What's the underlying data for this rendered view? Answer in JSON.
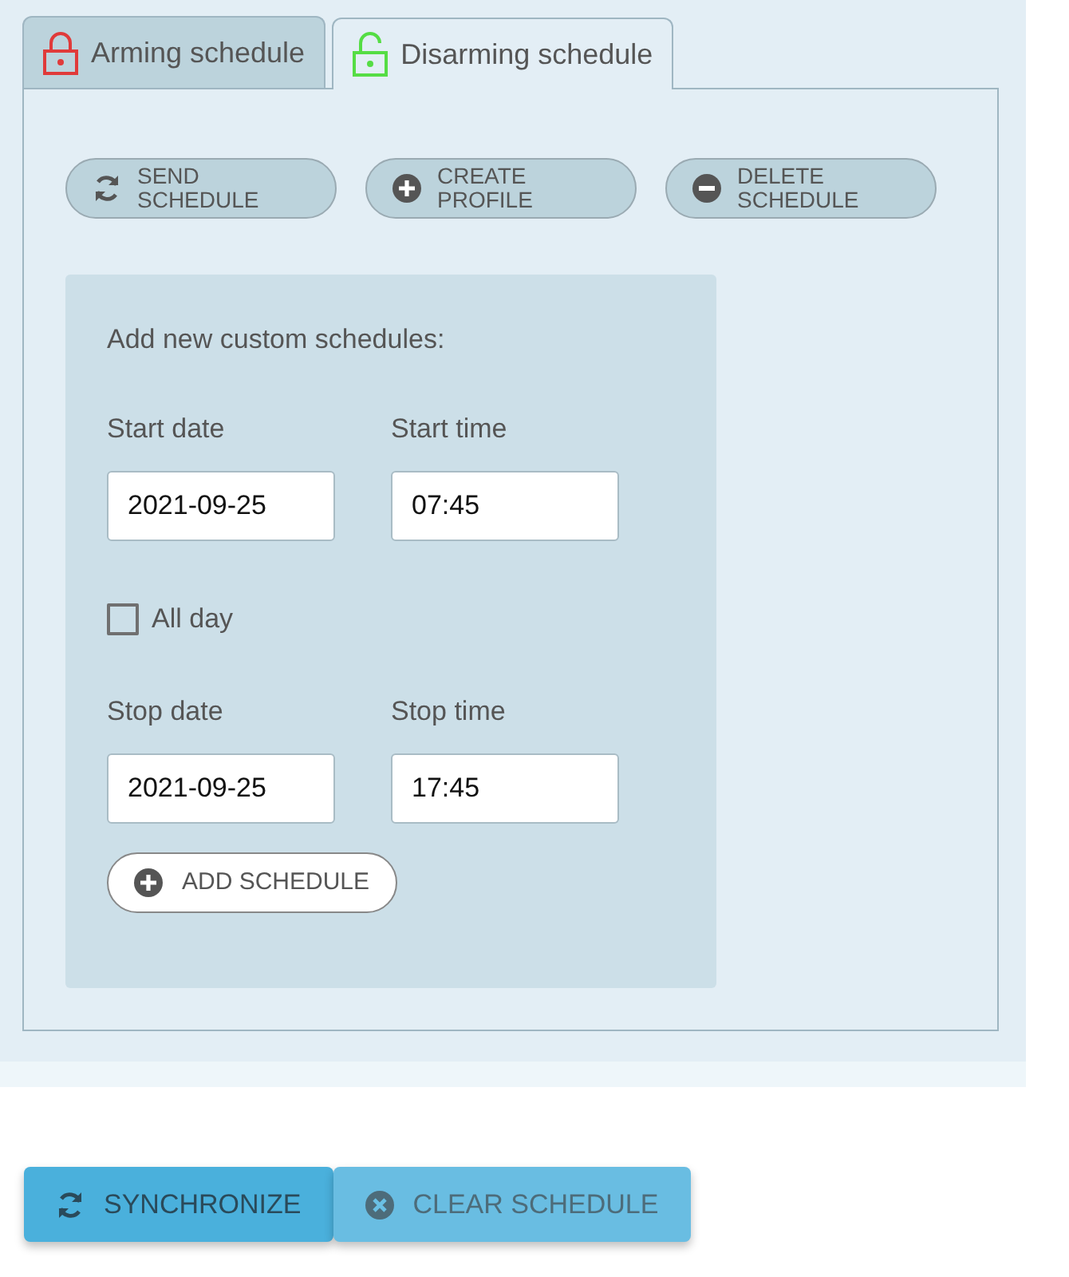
{
  "tabs": [
    {
      "label": "Arming schedule",
      "kind": "locked",
      "selected": false
    },
    {
      "label": "Disarming schedule",
      "kind": "unlocked",
      "selected": true
    }
  ],
  "actions": [
    {
      "label": "SEND\nSCHEDULE",
      "kind": "send"
    },
    {
      "label": "CREATE\nPROFILE",
      "kind": "create"
    },
    {
      "label": "DELETE\nSCHEDULE",
      "kind": "delete"
    }
  ],
  "form": {
    "title": "Add new custom schedules:",
    "start": [
      {
        "label": "Start date",
        "value": "2021-09-25"
      },
      {
        "label": "Start time",
        "value": "07:45"
      }
    ],
    "all_day": {
      "label": "All day",
      "checked": false
    },
    "stop": [
      {
        "label": "Stop date",
        "value": "2021-09-25"
      },
      {
        "label": "Stop time",
        "value": "17:45"
      }
    ],
    "add_button": {
      "label": "ADD SCHEDULE",
      "kind": "create"
    }
  },
  "footer_buttons": [
    {
      "label": "SYNCHRONIZE",
      "kind": "send",
      "disabled": false
    },
    {
      "label": "CLEAR SCHEDULE",
      "kind": "clear",
      "disabled": true
    }
  ]
}
